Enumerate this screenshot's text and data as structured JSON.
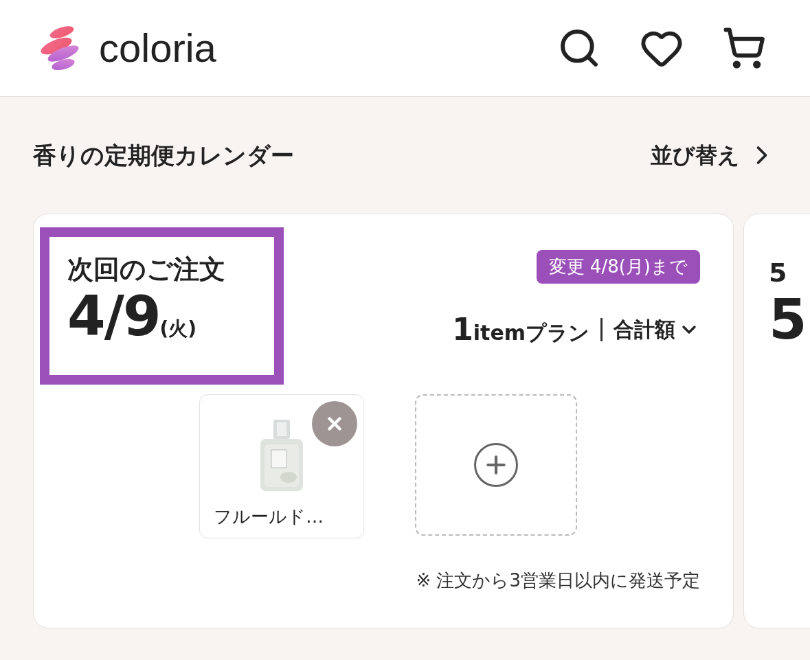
{
  "header": {
    "logo": "coloria"
  },
  "section": {
    "title": "香りの定期便カレンダー",
    "sort_link": "並び替え"
  },
  "cards": [
    {
      "label": "次回のご注文",
      "highlighted": true,
      "date_number": "4/9",
      "date_weekday": "(火)",
      "deadline_badge": "変更 4/8(月)まで",
      "plan_count": "1",
      "plan_label": "itemプラン",
      "total_toggle": "合計額",
      "items": [
        {
          "kind": "product",
          "name": "フルールド…"
        },
        {
          "kind": "add"
        }
      ],
      "note": "※ 注文から3営業日以内に発送予定"
    },
    {
      "label": "5",
      "highlighted": false,
      "date_number": "5"
    }
  ]
}
